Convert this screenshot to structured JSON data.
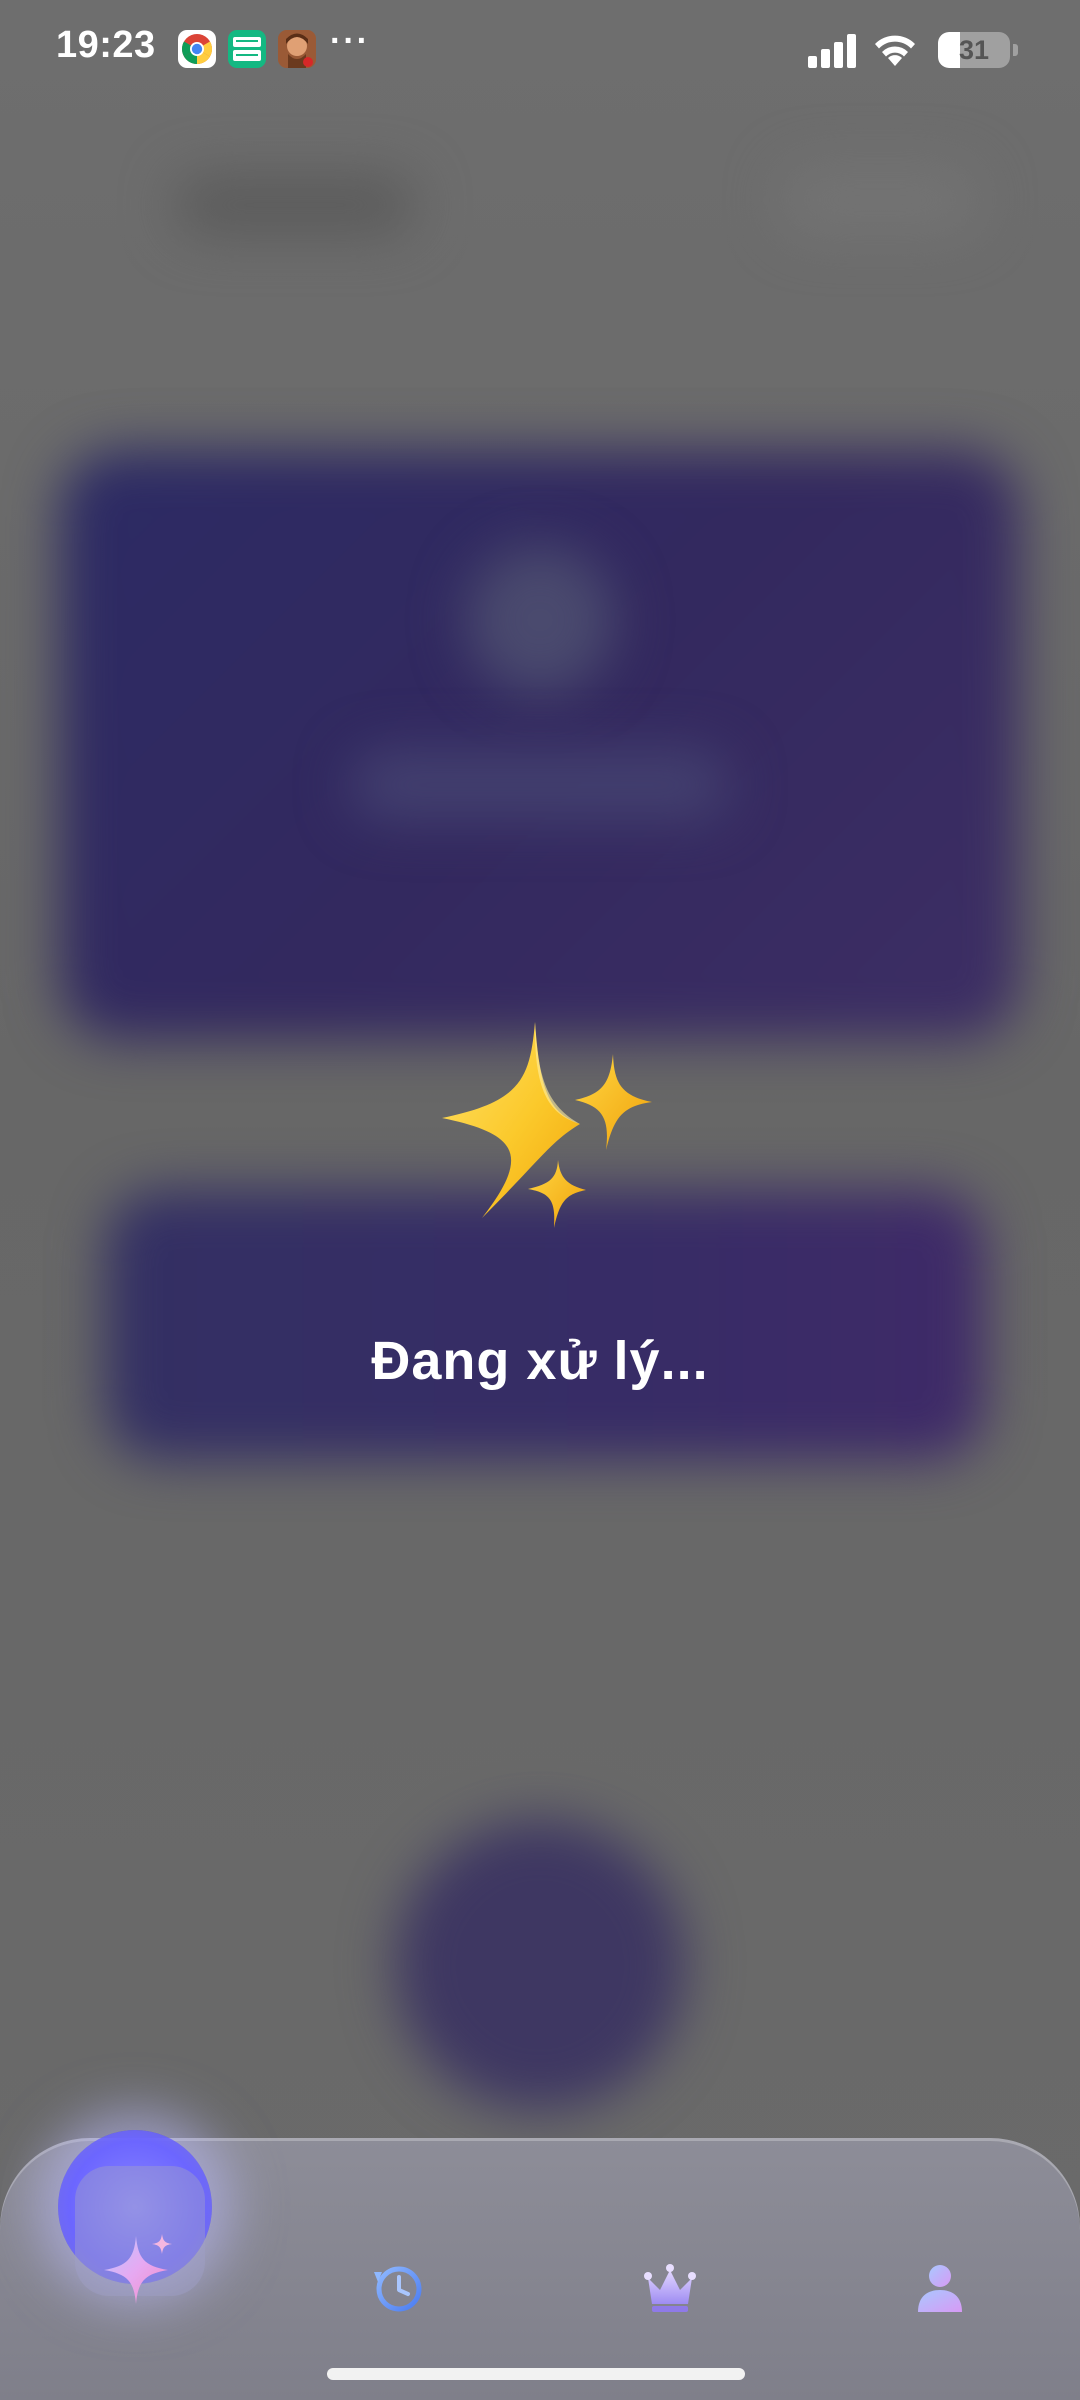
{
  "status_bar": {
    "time": "19:23",
    "notification_icons": [
      "chrome-icon",
      "temp-mail-icon",
      "game-avatar-icon"
    ],
    "more_indicator": "···",
    "battery_level": "31",
    "battery_fraction": 0.31
  },
  "processing": {
    "icon": "sparkles-icon",
    "label": "Đang xử lý..."
  },
  "tab_bar": {
    "tabs": [
      {
        "name": "create",
        "icon": "sparkle-icon",
        "active": true
      },
      {
        "name": "history",
        "icon": "history-clock-icon",
        "active": false
      },
      {
        "name": "premium",
        "icon": "crown-icon",
        "active": false
      },
      {
        "name": "profile",
        "icon": "user-icon",
        "active": false
      }
    ]
  },
  "colors": {
    "overlay_gray": "#696969",
    "card_purple": "#33295f",
    "sparkle_gold": "#f8c825",
    "tab_accent": "#6c66ff"
  }
}
